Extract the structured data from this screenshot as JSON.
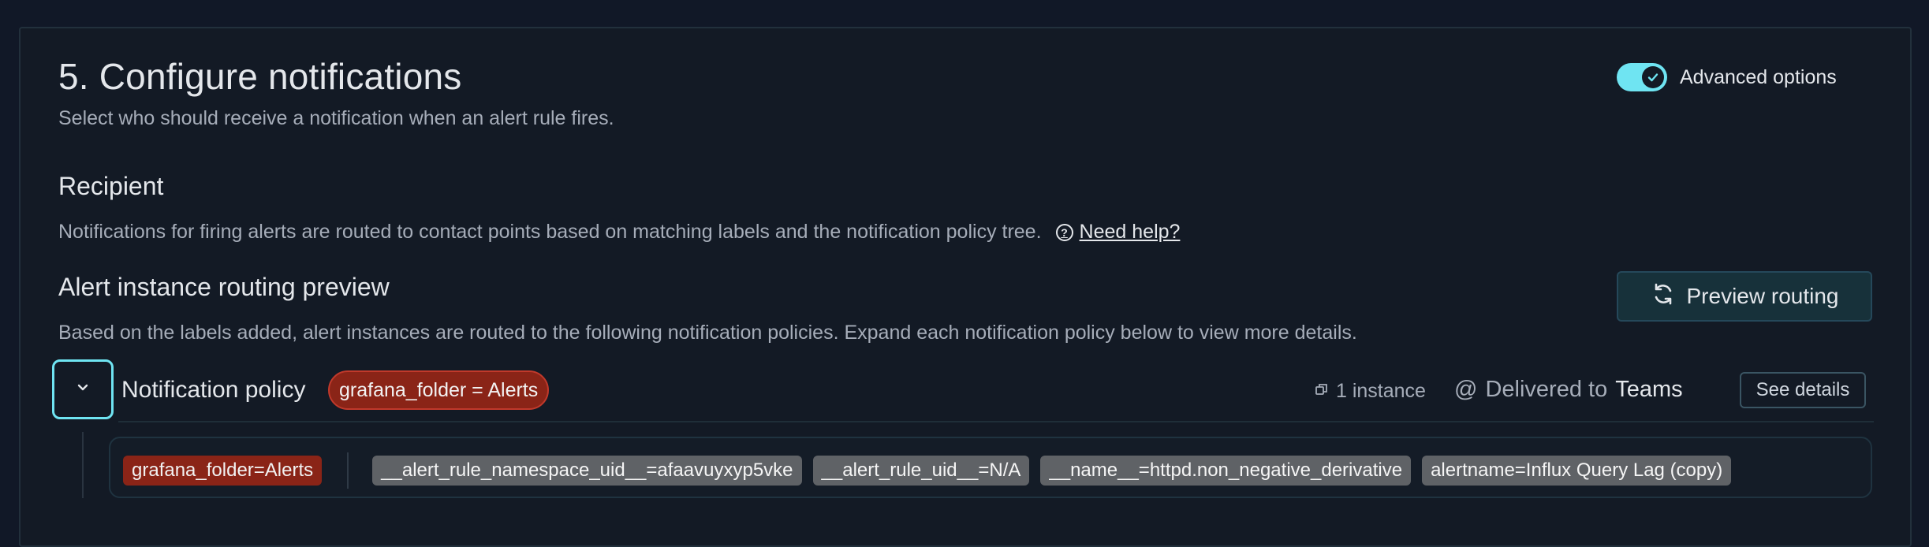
{
  "section": {
    "title": "5. Configure notifications",
    "subtitle": "Select who should receive a notification when an alert rule fires."
  },
  "advanced_toggle": {
    "label": "Advanced options",
    "checked": true
  },
  "recipient": {
    "title": "Recipient",
    "description": "Notifications for firing alerts are routed to contact points based on matching labels and the notification policy tree.",
    "help_link": "Need help?"
  },
  "routing_preview": {
    "title": "Alert instance routing preview",
    "description": "Based on the labels added, alert instances are routed to the following notification policies. Expand each notification policy below to view more details.",
    "button_label": "Preview routing"
  },
  "policy": {
    "label": "Notification policy",
    "matcher": "grafana_folder = Alerts",
    "instances": "1 instance",
    "delivered_prefix": "Delivered to",
    "contact_point": "Teams",
    "see_details": "See details"
  },
  "labels": [
    {
      "text": "grafana_folder=Alerts",
      "style": "red"
    },
    {
      "text": "__alert_rule_namespace_uid__=afaavuyxyp5vke",
      "style": "gray"
    },
    {
      "text": "__alert_rule_uid__=N/A",
      "style": "gray"
    },
    {
      "text": "__name__=httpd.non_negative_derivative",
      "style": "gray"
    },
    {
      "text": "alertname=Influx Query Lag (copy)",
      "style": "gray"
    }
  ],
  "colors": {
    "accent": "#6fe4f2",
    "matcher_red": "#8a2417",
    "label_gray": "#5f6266"
  }
}
